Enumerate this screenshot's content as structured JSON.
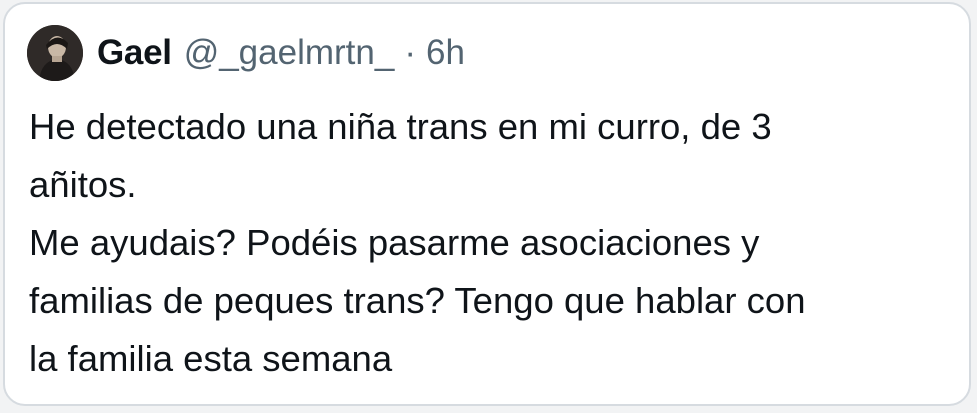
{
  "tweet": {
    "author": {
      "name": "Gael",
      "handle": "@_gaelmrtn_",
      "avatar_icon": "profile-photo"
    },
    "separator": "·",
    "timestamp": "6h",
    "text_lines": [
      "He detectado una niña trans en mi curro, de 3",
      "añitos.",
      "Me ayudais? Podéis pasarme asociaciones y",
      "familias de peques trans? Tengo que hablar con",
      "la familia esta semana"
    ]
  },
  "colors": {
    "text_primary": "#0f1419",
    "text_secondary": "#536471",
    "card_border": "#d6dbe0",
    "background": "#ffffff"
  }
}
